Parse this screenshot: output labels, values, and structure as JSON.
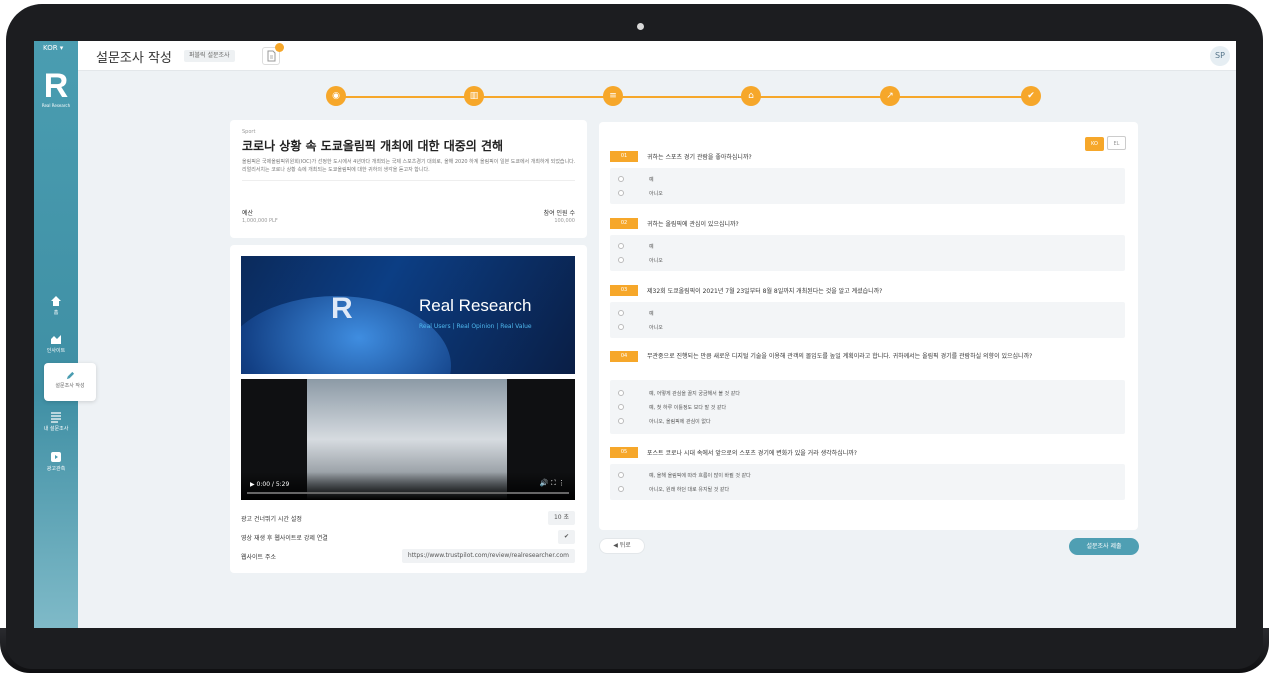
{
  "sidebar": {
    "language": "KOR ▾",
    "logo_text": "Real Research",
    "items": [
      {
        "label": "홈"
      },
      {
        "label": "인사이트"
      },
      {
        "label": "설문조사 작성"
      },
      {
        "label": "내 설문조사"
      },
      {
        "label": "광고관측"
      }
    ]
  },
  "header": {
    "title": "설문조사 작성",
    "survey_type": "퍼블릭 설문조사",
    "avatar": "SP"
  },
  "colors": {
    "accent": "#f6a72a",
    "brand": "#4a9db1"
  },
  "steps": [
    "camera-icon",
    "bank-icon",
    "list-icon",
    "house-icon",
    "trend-icon",
    "check-icon"
  ],
  "info": {
    "category": "Sport",
    "title": "코로나 상황 속 도쿄올림픽 개최에 대한 대중의 견해",
    "description": "올림픽은 국제올림픽위원회(IOC)가 선정한 도시에서 4년마다 개최되는 국제 스포츠경기 대회로, 올해 2020 하계 올림픽이 일본 도쿄에서 개최하게 되었습니다. 리얼리서치는 코로나 상황 속에 개최되는 도쿄올림픽에 대한 귀하의 생각을 듣고자 합니다.",
    "budget_label": "예산",
    "budget_value": "1,000,000 PLF",
    "participants_label": "참여 인원 수",
    "participants_value": "100,000"
  },
  "media": {
    "banner_brand": "Real Research",
    "banner_tagline": "Real Users | Real Opinion | Real Value",
    "video_time": "0:00 / 5:29",
    "settings": [
      {
        "label": "광고 건너뛰기 시간 설정",
        "value": "10 초"
      },
      {
        "label": "영상 재생 후 웹사이트로 강제 연결",
        "value": "✔"
      },
      {
        "label": "웹사이트 주소",
        "value": "https://www.trustpilot.com/review/realresearcher.com"
      }
    ]
  },
  "language_toggle": {
    "on": "KO",
    "off": "EL"
  },
  "questions": [
    {
      "num": "01",
      "text": "귀하는 스포츠 경기 관람을 좋아하십니까?",
      "options": [
        "예",
        "아니오"
      ]
    },
    {
      "num": "02",
      "text": "귀하는 올림픽에 관심이 있으십니까?",
      "options": [
        "예",
        "아니오"
      ]
    },
    {
      "num": "03",
      "text": "제32회 도쿄올림픽이 2021년 7월 23일부터 8월 8일까지 개최된다는 것을 알고 계셨습니까?",
      "options": [
        "예",
        "아니오"
      ]
    },
    {
      "num": "04",
      "text": "무관중으로 진행되는 만큼 새로운 디지털 기술을 이용해 관객의 몰입도를 높일 계획이라고 합니다. 귀하께서는 올림픽 경기를 관람하실 의향이 있으십니까?",
      "options": [
        "예, 어떻게 관심을 끌지 궁금해서 볼 것 같다",
        "예, 첫 하루 이틀정도 보다 말 것 같다",
        "아니오, 올림픽에 관심이 없다"
      ]
    },
    {
      "num": "05",
      "text": "포스트 코로나 시대 속에서 앞으로의 스포츠 경기에 변화가 있을 거라 생각하십니까?",
      "options": [
        "예, 올해 올림픽에 따라 흐름이 많이 바뀔 것 같다",
        "아니오, 원래 하던 대로 유지될 것 같다"
      ]
    }
  ],
  "footer": {
    "back": "◀ 뒤로",
    "submit": "설문조사 제출"
  }
}
